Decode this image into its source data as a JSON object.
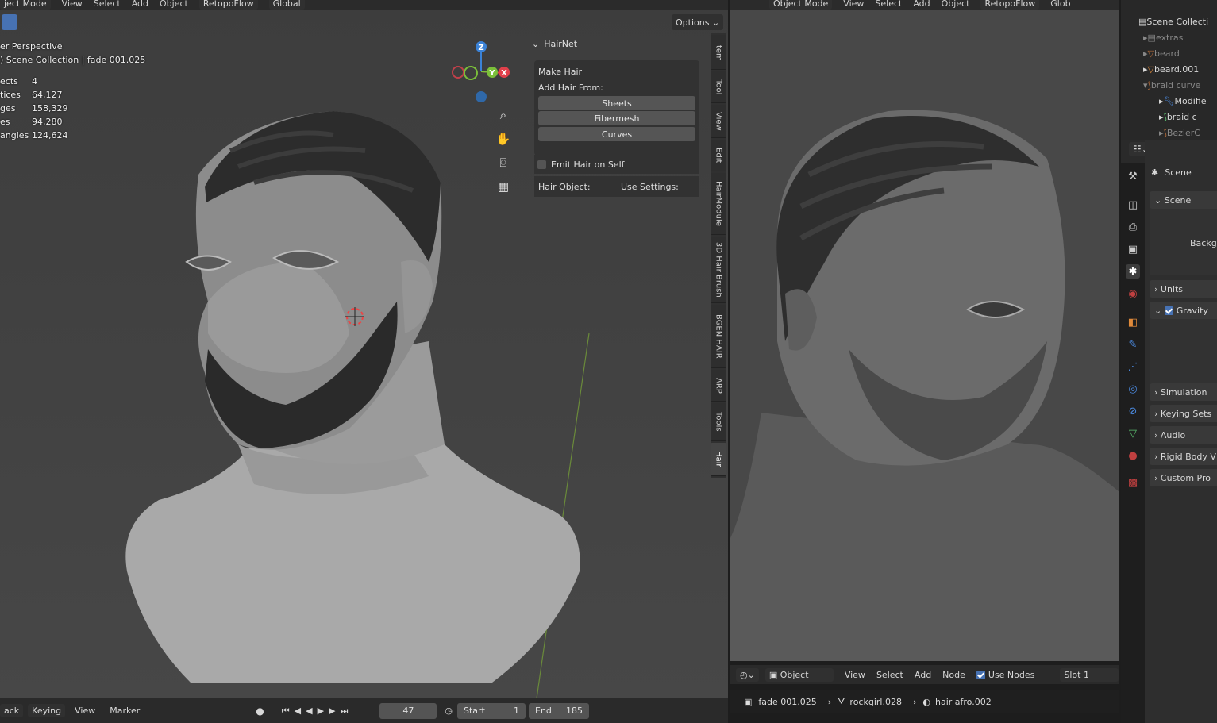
{
  "left_viewport": {
    "header": {
      "mode": "ject Mode",
      "menus": [
        "View",
        "Select",
        "Add",
        "Object",
        "RetopoFlow"
      ],
      "orientation": "Global",
      "options": "Options"
    },
    "overlay": {
      "view_name": "er Perspective",
      "collection": ") Scene Collection | fade 001.025",
      "stats": [
        {
          "label": "ects",
          "value": "4"
        },
        {
          "label": "tices",
          "value": "64,127"
        },
        {
          "label": "ges",
          "value": "158,329"
        },
        {
          "label": "es",
          "value": "94,280"
        },
        {
          "label": "angles",
          "value": "124,624"
        }
      ]
    },
    "gizmo": {
      "z": "Z",
      "x": "X",
      "y": "Y"
    },
    "n_panel": {
      "title": "HairNet",
      "make_hair": "Make Hair",
      "add_from": "Add Hair From:",
      "buttons": [
        "Sheets",
        "Fibermesh",
        "Curves"
      ],
      "emit": "Emit Hair on Self",
      "hair_object": "Hair Object:",
      "use_settings": "Use Settings:"
    },
    "tabs": [
      "Item",
      "Tool",
      "View",
      "Edit",
      "HairModule",
      "3D Hair Brush",
      "BGEN HAIR",
      "ARP",
      "Tools",
      "Hair"
    ]
  },
  "timeline": {
    "playback": "ack",
    "keying": "Keying",
    "view": "View",
    "marker": "Marker",
    "current_frame": "47",
    "start_label": "Start",
    "start": "1",
    "end_label": "End",
    "end": "185"
  },
  "right_viewport": {
    "header": {
      "mode": "Object Mode",
      "menus": [
        "View",
        "Select",
        "Add",
        "Object",
        "RetopoFlow"
      ],
      "orientation": "Glob"
    },
    "node_header": {
      "object": "Object",
      "view": "View",
      "select": "Select",
      "add": "Add",
      "node": "Node",
      "use_nodes": "Use Nodes",
      "slot": "Slot 1"
    },
    "breadcrumb": {
      "object": "fade 001.025",
      "mesh": "rockgirl.028",
      "material": "hair afro.002"
    }
  },
  "outliner": {
    "rows": [
      {
        "label": "Scene Collecti"
      },
      {
        "label": "extras"
      },
      {
        "label": "beard"
      },
      {
        "label": "beard.001"
      },
      {
        "label": "braid curve"
      },
      {
        "label": "Modifie"
      },
      {
        "label": "braid c"
      },
      {
        "label": "BezierC"
      }
    ]
  },
  "properties": {
    "scene_tab": "Scene",
    "scene_section": "Scene",
    "background": "Backg",
    "sections": [
      "Units",
      "Gravity",
      "Simulation",
      "Keying Sets",
      "Audio",
      "Rigid Body V",
      "Custom Pro"
    ]
  },
  "colors": {
    "accent": "#4772b3",
    "axis_x": "#e0404a",
    "axis_y": "#7bbf3a",
    "axis_z": "#3b82d6"
  }
}
